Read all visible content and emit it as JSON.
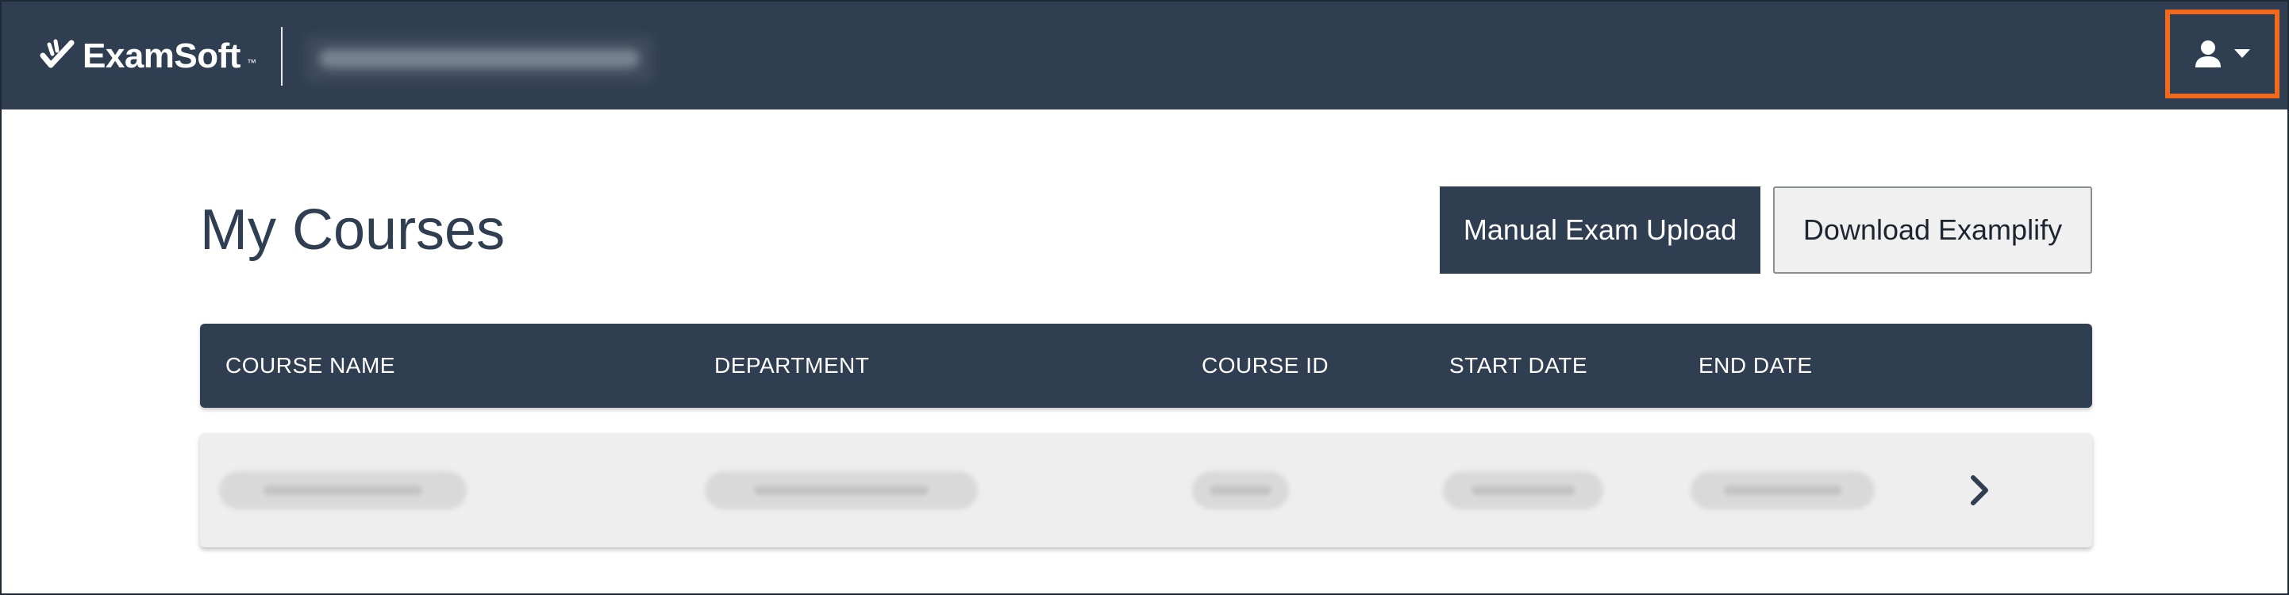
{
  "header": {
    "brand": "ExamSoft",
    "brand_tm": "™",
    "org_name_redacted": "",
    "user_menu_icon": "user-icon",
    "dropdown_icon": "caret-down-icon",
    "highlight_color": "#f26a1b",
    "bar_color": "#2f3e50"
  },
  "page": {
    "title": "My Courses",
    "manual_upload_label": "Manual Exam Upload",
    "download_label": "Download Examplify"
  },
  "table": {
    "columns": [
      "COURSE NAME",
      "DEPARTMENT",
      "COURSE ID",
      "START DATE",
      "END DATE"
    ],
    "rows": [
      {
        "course_name": "",
        "department": "",
        "course_id": "",
        "start_date": "",
        "end_date": "",
        "open_icon": "chevron-right-icon"
      }
    ]
  }
}
